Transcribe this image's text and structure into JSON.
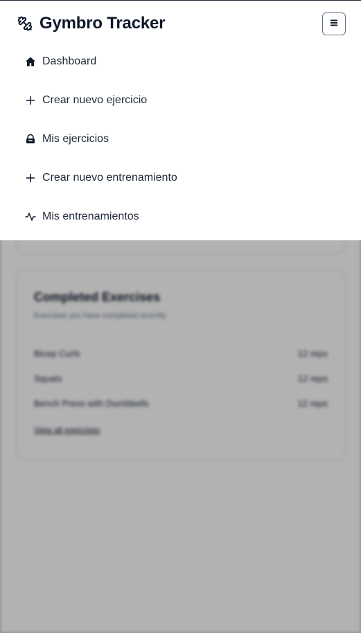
{
  "app": {
    "title": "Gymbro Tracker",
    "logo_icon": "dumbbell-icon",
    "menu_icon": "hamburger-icon"
  },
  "nav": {
    "items": [
      {
        "label": "Dashboard",
        "icon": "home-icon"
      },
      {
        "label": "Crear nuevo ejercicio",
        "icon": "plus-icon"
      },
      {
        "label": "Mis ejercicios",
        "icon": "bag-icon"
      },
      {
        "label": "Crear nuevo entrenamiento",
        "icon": "plus-icon"
      },
      {
        "label": "Mis entrenamientos",
        "icon": "activity-icon"
      }
    ]
  },
  "background": {
    "completed": {
      "title": "Completed Exercises",
      "subtitle": "Exercises you have completed recently",
      "rows": [
        {
          "name": "Bicep Curls",
          "reps": "12 reps"
        },
        {
          "name": "Squats",
          "reps": "12 reps"
        },
        {
          "name": "Bench Press with Dumbbells",
          "reps": "12 reps"
        }
      ],
      "view_all": "View all exercises"
    }
  },
  "colors": {
    "text": "#0f172a",
    "overlay": "#b3b3b3"
  }
}
